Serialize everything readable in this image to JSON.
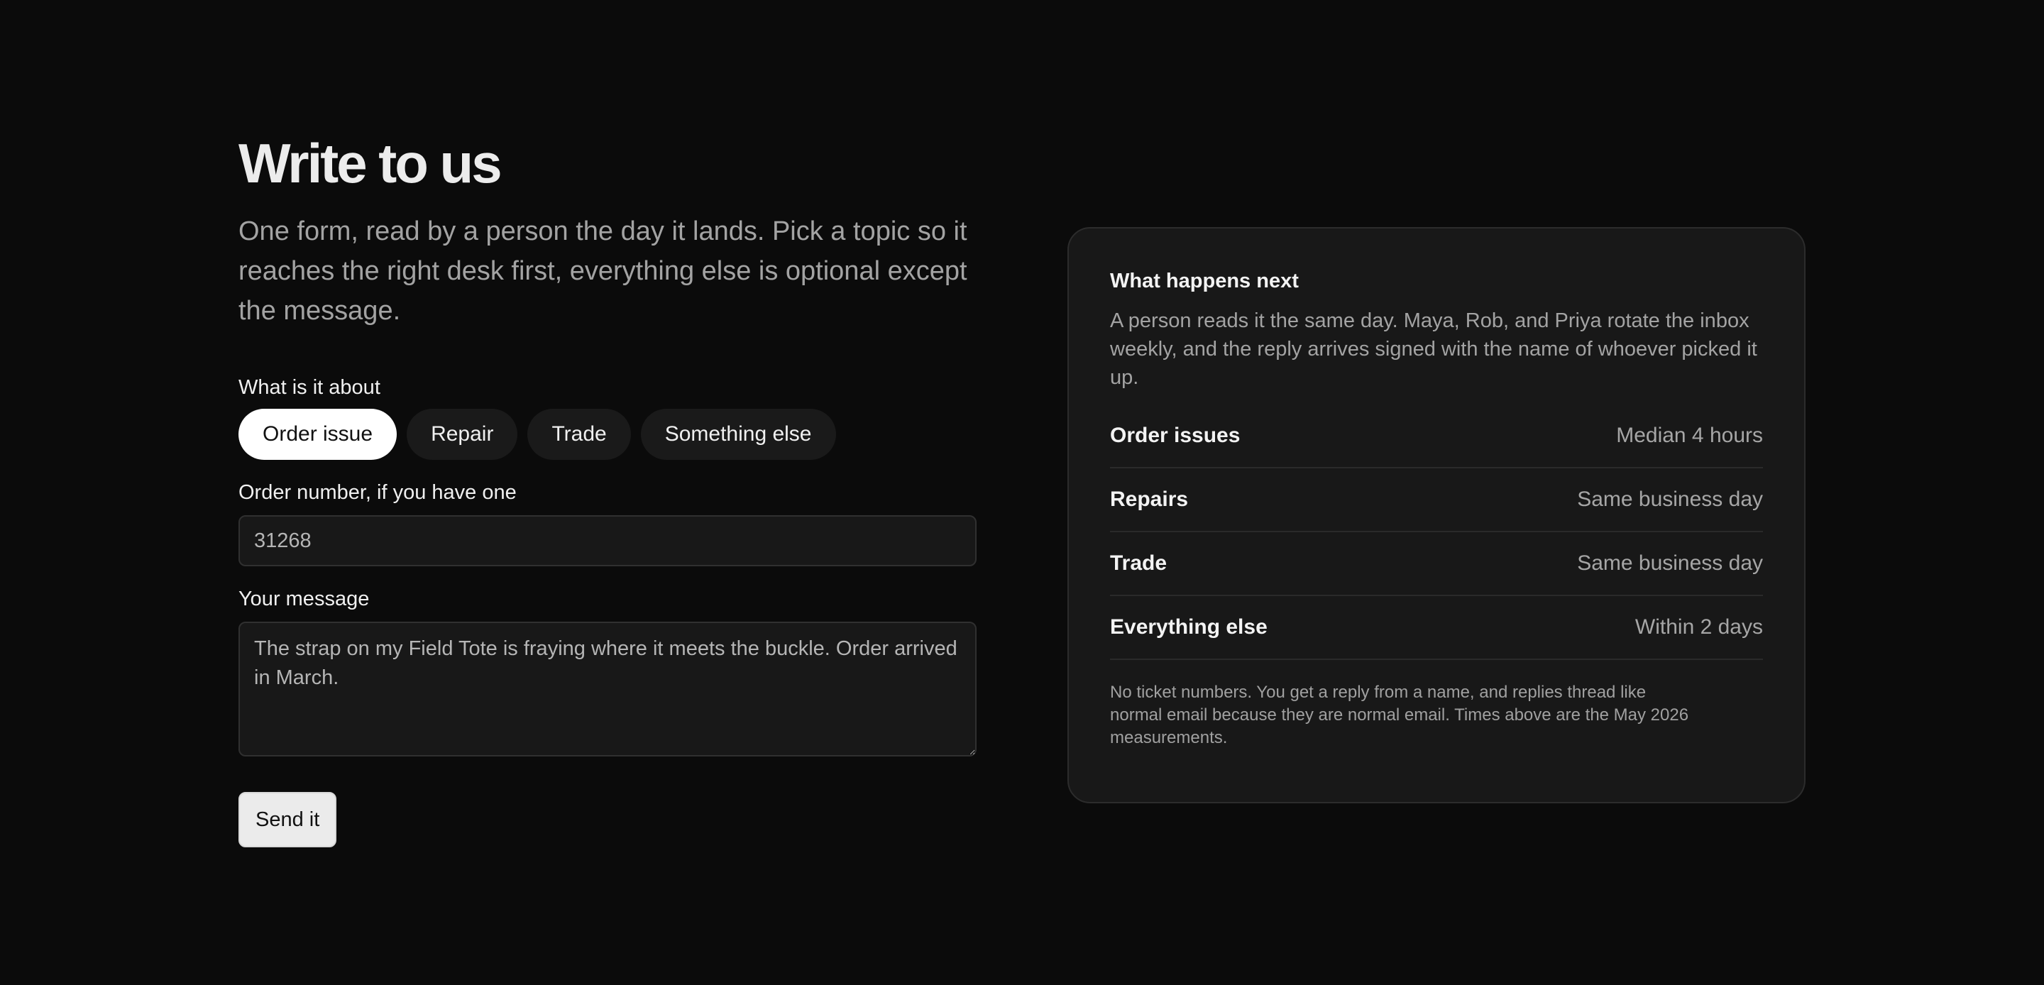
{
  "form": {
    "title": "Write to us",
    "intro": "One form, read by a person the day it lands. Pick a topic so it reaches the right desk first, everything else is optional except the message.",
    "topic_label": "What is it about",
    "topics": [
      {
        "label": "Order issue",
        "selected": true
      },
      {
        "label": "Repair",
        "selected": false
      },
      {
        "label": "Trade",
        "selected": false
      },
      {
        "label": "Something else",
        "selected": false
      }
    ],
    "order_label": "Order number, if you have one",
    "order_value": "31268",
    "message_label": "Your message",
    "message_value": "The strap on my Field Tote is fraying where it meets the buckle. Order arrived in March.",
    "send_label": "Send it"
  },
  "info": {
    "title": "What happens next",
    "body": "A person reads it the same day. Maya, Rob, and Priya rotate the inbox weekly, and the reply arrives signed with the name of whoever picked it up.",
    "rows": [
      {
        "name": "Order issues",
        "value": "Median 4 hours"
      },
      {
        "name": "Repairs",
        "value": "Same business day"
      },
      {
        "name": "Trade",
        "value": "Same business day"
      },
      {
        "name": "Everything else",
        "value": "Within 2 days"
      }
    ],
    "footnote": "No ticket numbers. You get a reply from a name, and replies thread like normal email because they are normal email. Times above are the May 2026 measurements."
  },
  "colors": {
    "background": "#0b0b0b",
    "card": "#181818",
    "selected_pill": "#ffffff",
    "pill": "#1a1a1a",
    "muted_text": "#a3a3a3"
  }
}
